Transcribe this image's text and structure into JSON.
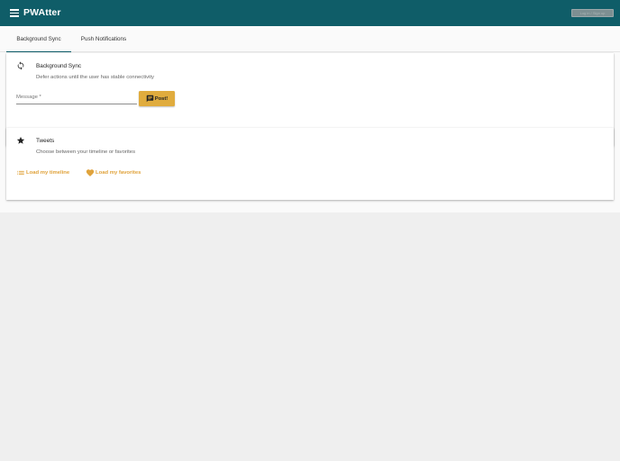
{
  "app": {
    "title": "PWAtter",
    "toolbar_button_label": "Log in / Sign up"
  },
  "tabs": [
    {
      "label": "Background Sync",
      "active": true
    },
    {
      "label": "Push Notifications",
      "active": false
    }
  ],
  "background_sync_card": {
    "icon": "sync-icon",
    "title": "Background Sync",
    "subtitle": "Defer actions until the user has stable connectivity",
    "message_field": {
      "label": "Message *",
      "value": ""
    },
    "post_button": {
      "icon": "message-icon",
      "label": "Post!"
    }
  },
  "tweets_card": {
    "icon": "star-icon",
    "title": "Tweets",
    "subtitle": "Choose between your timeline or favorites",
    "timeline_button": {
      "icon": "list-icon",
      "label": "Load my timeline"
    },
    "favorites_button": {
      "icon": "heart-icon",
      "label": "Load my favorites"
    }
  },
  "colors": {
    "toolbar": "#0f5d68",
    "accent": "#e0ac3e",
    "page_background": "#efefef",
    "content_background": "#fafafa"
  }
}
